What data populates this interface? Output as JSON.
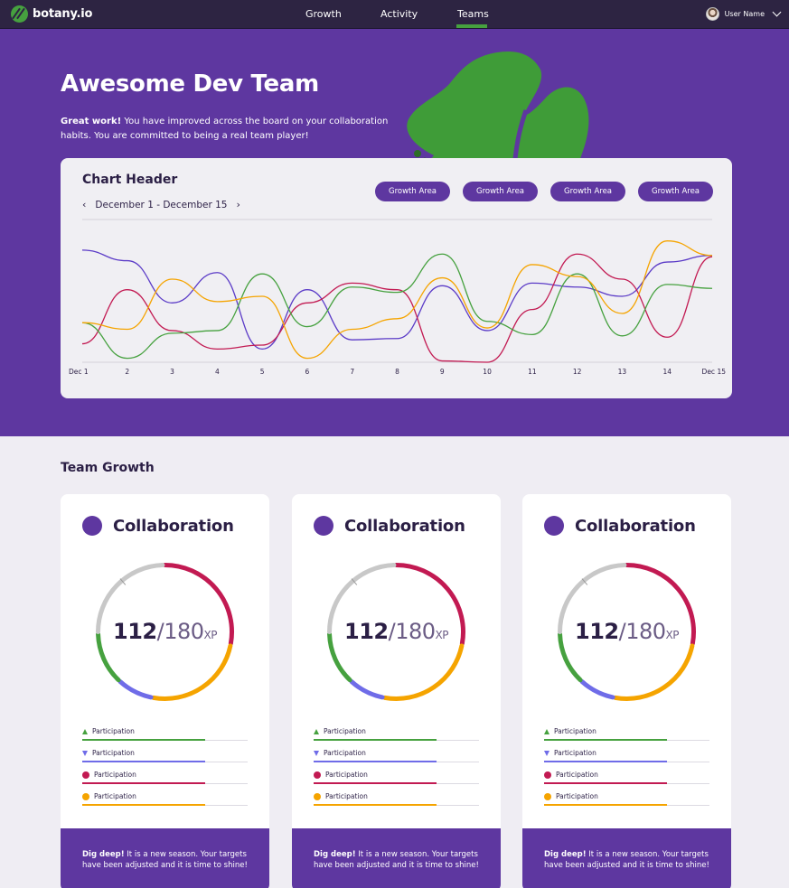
{
  "nav": {
    "logo_text": "botany.io",
    "links": [
      "Growth",
      "Activity",
      "Teams"
    ],
    "active_link": "Teams",
    "user_name": "User Name",
    "icons": [
      "botany-logo-icon",
      "user-avatar",
      "chevron-down-icon"
    ]
  },
  "hero": {
    "title": "Awesome Dev Team",
    "message_bold": "Great work!",
    "message_rest": " You have improved across the board on your collaboration habits. You are committed to being a real team player!"
  },
  "chart": {
    "header": "Chart Header",
    "prev_arrow": "‹",
    "date_range": "December 1 - December 15",
    "next_arrow": "›",
    "filters": [
      "Growth Area",
      "Growth Area",
      "Growth Area",
      "Growth Area"
    ]
  },
  "chart_data": {
    "type": "line",
    "x": [
      "Dec 1",
      "2",
      "3",
      "4",
      "5",
      "6",
      "7",
      "8",
      "9",
      "10",
      "11",
      "12",
      "13",
      "14",
      "Dec 15"
    ],
    "ylim": [
      0,
      100
    ],
    "grid": false,
    "series": [
      {
        "color": "#5b3bc7",
        "values": [
          85,
          77,
          45,
          68,
          10,
          55,
          17,
          18,
          58,
          24,
          60,
          57,
          50,
          76,
          81
        ]
      },
      {
        "color": "#c21a52",
        "values": [
          14,
          55,
          24,
          10,
          13,
          45,
          60,
          55,
          1,
          0,
          40,
          82,
          63,
          19,
          80
        ]
      },
      {
        "color": "#46a13f",
        "values": [
          30,
          3,
          22,
          24,
          67,
          27,
          57,
          53,
          82,
          31,
          21,
          67,
          20,
          59,
          56
        ]
      },
      {
        "color": "#f5a400",
        "values": [
          30,
          25,
          63,
          46,
          50,
          3,
          25,
          33,
          64,
          26,
          74,
          65,
          37,
          92,
          81
        ]
      }
    ]
  },
  "team": {
    "section_title": "Team Growth",
    "cards": [
      {
        "title": "Collaboration",
        "current": "112",
        "slash": "/",
        "total": "180",
        "unit": "XP",
        "legend": [
          {
            "label": "Participation",
            "marker": "triangle-up",
            "color": "#46a13f"
          },
          {
            "label": "Participation",
            "marker": "triangle-down",
            "color": "#6f6ce8"
          },
          {
            "label": "Participation",
            "marker": "dot",
            "color": "#c21a52"
          },
          {
            "label": "Participation",
            "marker": "dot",
            "color": "#f5a400"
          }
        ],
        "footer_bold": "Dig deep!",
        "footer_rest": " It is a new season. Your targets have been adjusted and it is time to shine!"
      },
      {
        "title": "Collaboration",
        "current": "112",
        "slash": "/",
        "total": "180",
        "unit": "XP",
        "legend": [
          {
            "label": "Participation",
            "marker": "triangle-up",
            "color": "#46a13f"
          },
          {
            "label": "Participation",
            "marker": "triangle-down",
            "color": "#6f6ce8"
          },
          {
            "label": "Participation",
            "marker": "dot",
            "color": "#c21a52"
          },
          {
            "label": "Participation",
            "marker": "dot",
            "color": "#f5a400"
          }
        ],
        "footer_bold": "Dig deep!",
        "footer_rest": " It is a new season. Your targets have been adjusted and it is time to shine!"
      },
      {
        "title": "Collaboration",
        "current": "112",
        "slash": "/",
        "total": "180",
        "unit": "XP",
        "legend": [
          {
            "label": "Participation",
            "marker": "triangle-up",
            "color": "#46a13f"
          },
          {
            "label": "Participation",
            "marker": "triangle-down",
            "color": "#6f6ce8"
          },
          {
            "label": "Participation",
            "marker": "dot",
            "color": "#c21a52"
          },
          {
            "label": "Participation",
            "marker": "dot",
            "color": "#f5a400"
          }
        ],
        "footer_bold": "Dig deep!",
        "footer_rest": " It is a new season. Your targets have been adjusted and it is time to shine!"
      }
    ]
  },
  "colors": {
    "brand_purple": "#5e37a0",
    "nav_bg": "#2d2442",
    "accent_green": "#46a13f",
    "ring_red": "#c21a52",
    "ring_orange": "#f5a400",
    "ring_blue": "#6f6ce8",
    "ring_grey": "#c8c8c8"
  }
}
